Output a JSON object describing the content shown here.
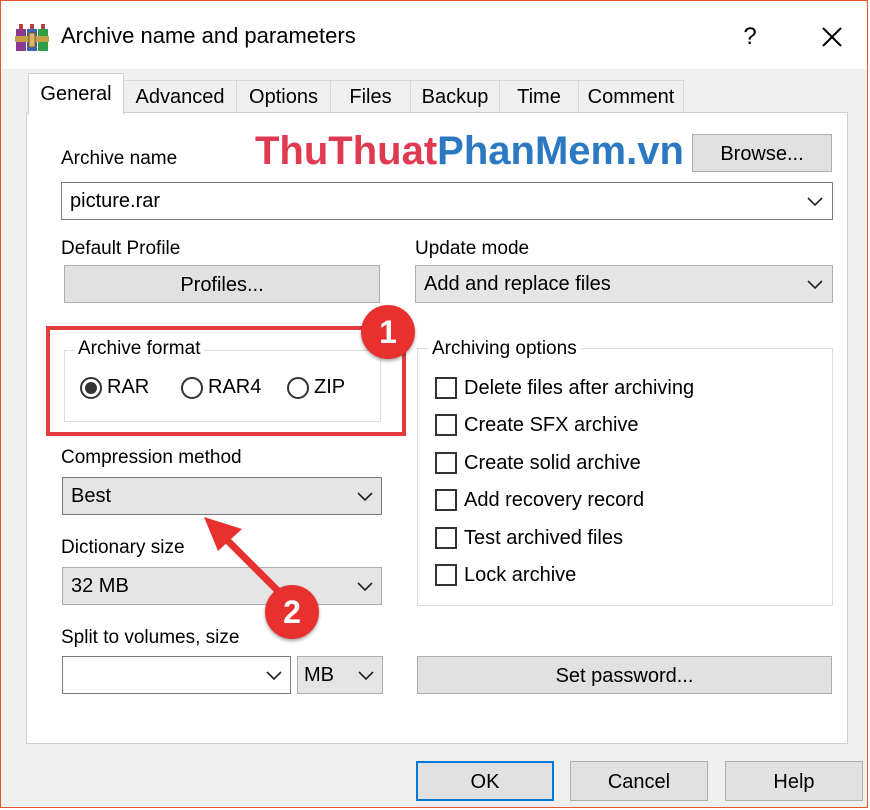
{
  "window": {
    "title": "Archive name and parameters",
    "help_glyph": "?",
    "accent_color": "#e3572f"
  },
  "tabs": [
    {
      "label": "General",
      "active": true
    },
    {
      "label": "Advanced",
      "active": false
    },
    {
      "label": "Options",
      "active": false
    },
    {
      "label": "Files",
      "active": false
    },
    {
      "label": "Backup",
      "active": false
    },
    {
      "label": "Time",
      "active": false
    },
    {
      "label": "Comment",
      "active": false
    }
  ],
  "watermark": {
    "part1": "ThuThuat",
    "part2": "PhanMem.vn"
  },
  "archive_name": {
    "label": "Archive name",
    "value": "picture.rar",
    "browse_label": "Browse..."
  },
  "default_profile": {
    "label": "Default Profile",
    "button_label": "Profiles..."
  },
  "update_mode": {
    "label": "Update mode",
    "value": "Add and replace files"
  },
  "archive_format": {
    "label": "Archive format",
    "options": [
      {
        "label": "RAR",
        "selected": true
      },
      {
        "label": "RAR4",
        "selected": false
      },
      {
        "label": "ZIP",
        "selected": false
      }
    ]
  },
  "archiving_options": {
    "label": "Archiving options",
    "items": [
      {
        "label": "Delete files after archiving",
        "checked": false
      },
      {
        "label": "Create SFX archive",
        "checked": false
      },
      {
        "label": "Create solid archive",
        "checked": false
      },
      {
        "label": "Add recovery record",
        "checked": false
      },
      {
        "label": "Test archived files",
        "checked": false
      },
      {
        "label": "Lock archive",
        "checked": false
      }
    ]
  },
  "compression_method": {
    "label": "Compression method",
    "value": "Best"
  },
  "dictionary_size": {
    "label": "Dictionary size",
    "value": "32 MB"
  },
  "split_volumes": {
    "label": "Split to volumes, size",
    "value": "",
    "unit": "MB"
  },
  "set_password_label": "Set password...",
  "footer": {
    "ok_label": "OK",
    "cancel_label": "Cancel",
    "help_label": "Help"
  },
  "annotations": {
    "badge1": "1",
    "badge2": "2",
    "color": "#e23b3b"
  }
}
